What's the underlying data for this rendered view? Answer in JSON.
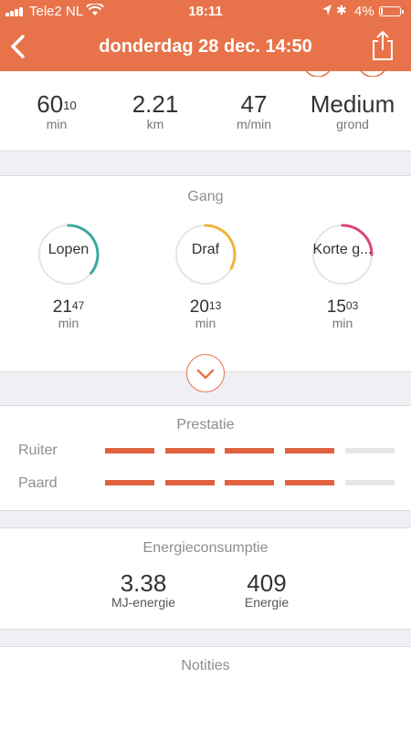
{
  "status_bar": {
    "carrier": "Tele2 NL",
    "time": "18:11",
    "battery_percent": "4%",
    "signal_bars": 4,
    "battery_level": 0.04
  },
  "nav": {
    "title": "donderdag 28 dec. 14:50",
    "back_icon": "chevron-left-icon",
    "share_icon": "share-icon"
  },
  "summary": [
    {
      "value": "60",
      "sup": "10",
      "unit": "min"
    },
    {
      "value": "2.21",
      "sup": "",
      "unit": "km"
    },
    {
      "value": "47",
      "sup": "",
      "unit": "m/min"
    },
    {
      "value": "Medium",
      "sup": "",
      "unit": "grond"
    }
  ],
  "gait": {
    "title": "Gang",
    "items": [
      {
        "label": "Lopen",
        "value": "21",
        "sup": "47",
        "unit": "min",
        "color": "#3aa99f",
        "fraction": 0.36
      },
      {
        "label": "Draf",
        "value": "20",
        "sup": "13",
        "unit": "min",
        "color": "#f0b33f",
        "fraction": 0.33
      },
      {
        "label": "Korte g...",
        "value": "15",
        "sup": "03",
        "unit": "min",
        "color": "#d9437a",
        "fraction": 0.25
      }
    ]
  },
  "performance": {
    "title": "Prestatie",
    "rows": [
      {
        "label": "Ruiter",
        "rating": 4,
        "max": 5
      },
      {
        "label": "Paard",
        "rating": 4,
        "max": 5
      }
    ],
    "active_color": "#e0623e",
    "inactive_color": "#e6e6e6"
  },
  "energy": {
    "title": "Energieconsumptie",
    "items": [
      {
        "value": "3.38",
        "unit": "MJ-energie"
      },
      {
        "value": "409",
        "unit": "Energie"
      }
    ]
  },
  "notes": {
    "title": "Notities"
  },
  "colors": {
    "accent": "#e8734a"
  }
}
